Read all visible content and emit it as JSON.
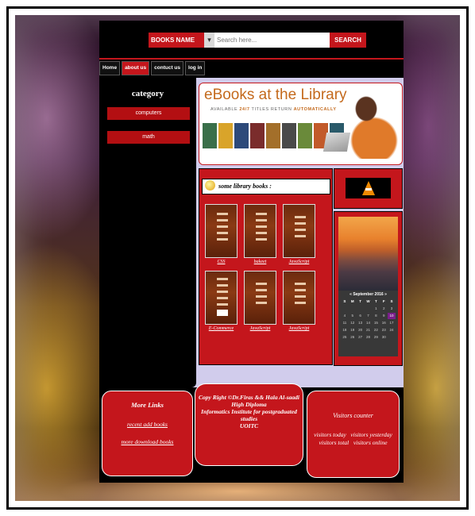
{
  "search": {
    "category_label": "BOOKS NAME",
    "placeholder": "Search here...",
    "button_label": "SEARCH"
  },
  "nav": {
    "home": "Home",
    "about": "about us",
    "contact": "contuct us",
    "login": "log in"
  },
  "category": {
    "title": "category",
    "items": [
      "computers",
      "math"
    ]
  },
  "banner": {
    "title": "eBooks at the Library",
    "subtitle_pre": "AVAILABLE",
    "subtitle_hours": "24/7",
    "subtitle_mid": "TITLES RETURN",
    "subtitle_end": "AUTOMATICALLY"
  },
  "library": {
    "heading": "some library books :",
    "books": [
      "CSS",
      "bakeet",
      "JavaScript",
      "E-Commerce",
      "JavaScript",
      "JavaScript"
    ]
  },
  "calendar": {
    "month": "September 2016",
    "day_headers": [
      "S",
      "M",
      "T",
      "W",
      "T",
      "F",
      "S"
    ],
    "days": [
      "",
      "",
      "",
      "",
      "1",
      "2",
      "3",
      "4",
      "5",
      "6",
      "7",
      "8",
      "9",
      "10",
      "11",
      "12",
      "13",
      "14",
      "15",
      "16",
      "17",
      "18",
      "19",
      "20",
      "21",
      "22",
      "23",
      "24",
      "25",
      "26",
      "27",
      "28",
      "29",
      "30",
      ""
    ],
    "highlighted_day": "10"
  },
  "footer": {
    "more_links": {
      "title": "More Links",
      "links": [
        "recent add books",
        "more download books"
      ]
    },
    "copyright": {
      "line1": "Copy Right ©Dr.Firas && Hala Al-saadi",
      "line2": "High Diploma",
      "line3": "Informatics Institute for postgraduated studies",
      "line4": "UOITC"
    },
    "visitors": {
      "title": "Visitors counter",
      "today": "visitors today",
      "yesterday": "visitors yesterday",
      "total": "visitors total",
      "online": "visitors online"
    }
  },
  "colors": {
    "accent": "#c4161c",
    "content_bg": "#d1ccec",
    "page_bg": "#000000"
  }
}
